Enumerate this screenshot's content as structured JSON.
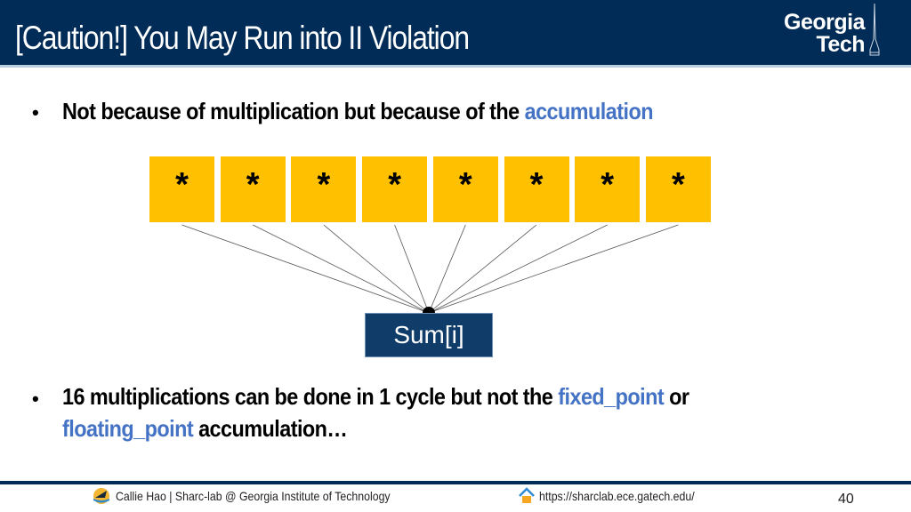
{
  "header": {
    "title": "[Caution!] You May Run into II Violation",
    "logo_line1": "Georgia",
    "logo_line2": "Tech"
  },
  "bullets": [
    {
      "text": "Not because of multiplication but because of the ",
      "highlight": "accumulation"
    },
    {
      "part1": "16 multiplications can be done in 1 cycle but not the ",
      "highlight1": "fixed_point",
      "part2": " or",
      "highlight2": "floating_point",
      "part3": " accumulation…"
    }
  ],
  "diagram": {
    "multipliers": [
      "*",
      "*",
      "*",
      "*",
      "*",
      "*",
      "*",
      "*"
    ],
    "sum_label": "Sum[i]",
    "colors": {
      "multiplier_fill": "#ffc000",
      "sum_fill": "#0f3c68",
      "line": "#555555"
    }
  },
  "footer": {
    "author": "Callie Hao | Sharc-lab @ Georgia Institute of Technology",
    "url": "https://sharclab.ece.gatech.edu/",
    "page_number": "40",
    "icons": [
      "sharc-lab-logo-icon",
      "home-icon"
    ]
  },
  "colors": {
    "header_bg": "#012c57",
    "accent": "#4472c4"
  }
}
